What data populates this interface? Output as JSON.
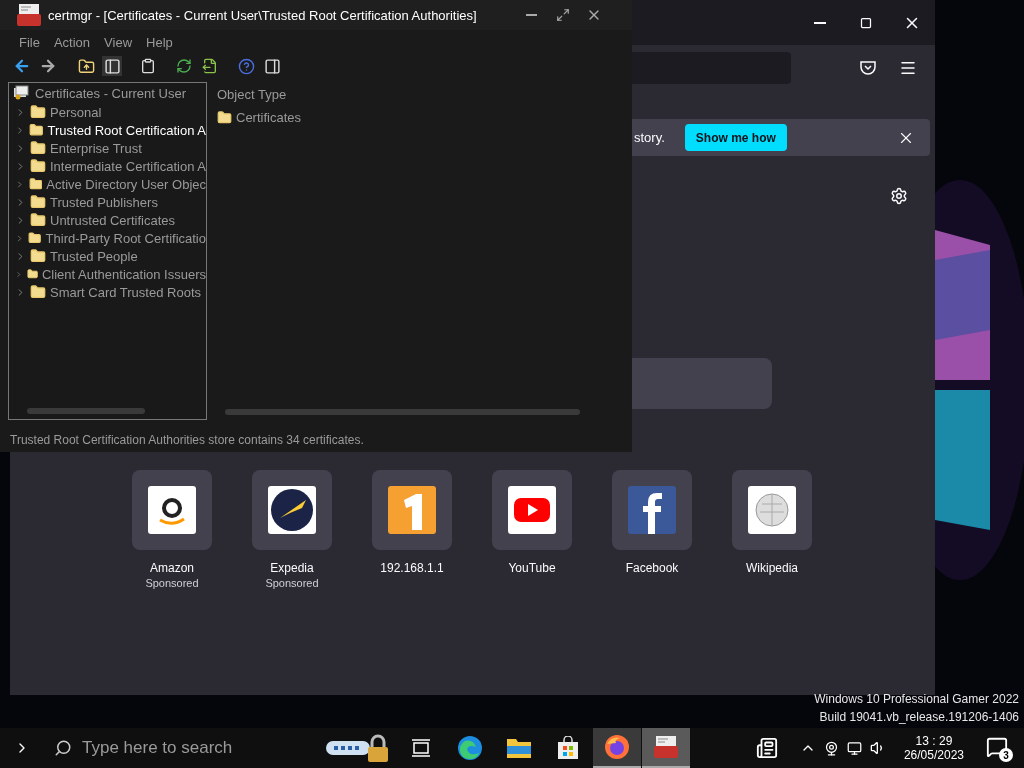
{
  "certmgr": {
    "title": "certmgr - [Certificates - Current User\\Trusted Root Certification Authorities]",
    "menu": [
      "File",
      "Action",
      "View",
      "Help"
    ],
    "tree": {
      "root": "Certificates - Current User",
      "items": [
        {
          "label": "Personal",
          "selected": false
        },
        {
          "label": "Trusted Root Certification A",
          "selected": true
        },
        {
          "label": "Enterprise Trust",
          "selected": false
        },
        {
          "label": "Intermediate Certification A",
          "selected": false
        },
        {
          "label": "Active Directory User Objec",
          "selected": false
        },
        {
          "label": "Trusted Publishers",
          "selected": false
        },
        {
          "label": "Untrusted Certificates",
          "selected": false
        },
        {
          "label": "Third-Party Root Certificatio",
          "selected": false
        },
        {
          "label": "Trusted People",
          "selected": false
        },
        {
          "label": "Client Authentication Issuers",
          "selected": false
        },
        {
          "label": "Smart Card Trusted Roots",
          "selected": false
        }
      ]
    },
    "list": {
      "column": "Object Type",
      "items": [
        "Certificates"
      ]
    },
    "status": "Trusted Root Certification Authorities store contains 34 certificates."
  },
  "browser": {
    "notification": {
      "text": "story.",
      "button": "Show me how"
    },
    "shortcuts": [
      {
        "kind": "amazon",
        "name": "Amazon",
        "sublabel": "Sponsored"
      },
      {
        "kind": "expedia",
        "name": "Expedia",
        "sublabel": "Sponsored"
      },
      {
        "kind": "router",
        "name": "192.168.1.1"
      },
      {
        "kind": "youtube",
        "name": "YouTube"
      },
      {
        "kind": "facebook",
        "name": "Facebook"
      },
      {
        "kind": "wikipedia",
        "name": "Wikipedia"
      }
    ]
  },
  "desktop": {
    "watermark": [
      "Windows 10 Professional Gamer 2022",
      "Build 19041.vb_release.191206-1406"
    ]
  },
  "taskbar": {
    "search_placeholder": "Type here to search",
    "apps": [
      {
        "kind": "keys",
        "running": false,
        "selected": false
      },
      {
        "kind": "taskview",
        "running": false,
        "selected": false
      },
      {
        "kind": "edge",
        "running": false,
        "selected": false
      },
      {
        "kind": "explorer",
        "running": false,
        "selected": false
      },
      {
        "kind": "store",
        "running": false,
        "selected": false
      },
      {
        "kind": "firefox",
        "running": true,
        "selected": false
      },
      {
        "kind": "certmgr",
        "running": true,
        "selected": true
      }
    ],
    "clock": {
      "time": "13 : 29",
      "date": "26/05/2023"
    },
    "notification_count": "3"
  }
}
